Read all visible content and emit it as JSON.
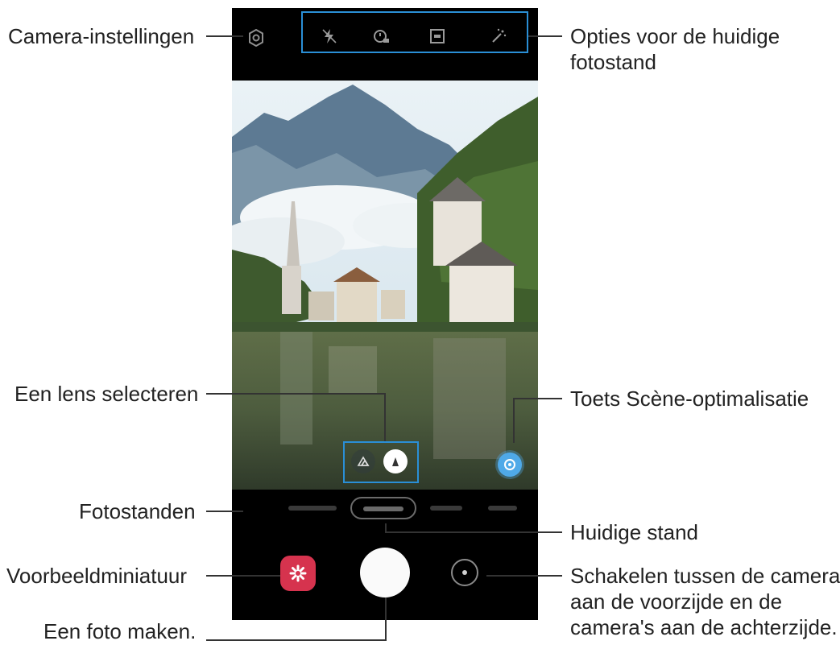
{
  "callouts": {
    "camera_settings": "Camera-instellingen",
    "shooting_options_line1": "Opties voor de huidige",
    "shooting_options_line2": "fotostand",
    "select_lens": "Een lens selecteren",
    "scene_optimizer": "Toets Scène-optimalisatie",
    "shooting_modes": "Fotostanden",
    "current_mode": "Huidige stand",
    "preview_thumbnail": "Voorbeeldminiatuur",
    "switch_cameras_line1": "Schakelen tussen de camera",
    "switch_cameras_line2": "aan de voorzijde en de",
    "switch_cameras_line3": "camera's aan de achterzijde.",
    "take_picture": "Een foto maken."
  },
  "colors": {
    "highlight_box": "#2a8fd6",
    "scene_button": "#4fa9e8",
    "gallery_thumbnail": "#d6334e"
  },
  "icons": {
    "settings": "gear-icon",
    "flash": "flash-off-icon",
    "timer": "timer-icon",
    "ratio": "aspect-ratio-icon",
    "filter": "magic-filter-icon",
    "lens_ultra_wide": "ultra-wide-lens-icon",
    "lens_wide": "wide-lens-icon",
    "scene": "scene-optimizer-icon",
    "switch_camera": "switch-camera-icon"
  }
}
